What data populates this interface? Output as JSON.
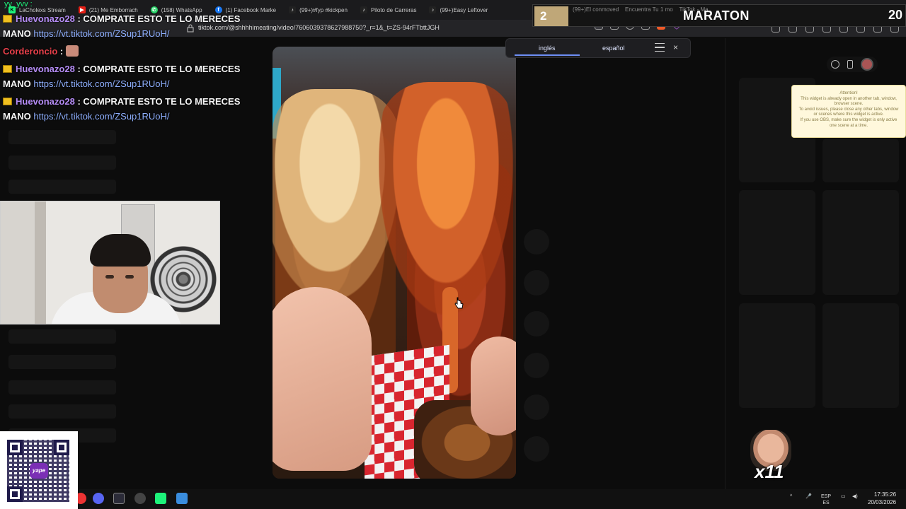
{
  "browser": {
    "tabs": [
      {
        "label": "LaCholexs Stream",
        "fav_color": "#1df27a"
      },
      {
        "label": "(21) Me Emborrach",
        "fav_color": "#e62117"
      },
      {
        "label": "(158) WhatsApp",
        "fav_color": "#25d366"
      },
      {
        "label": "(1) Facebook Marke",
        "fav_color": "#1877f2"
      },
      {
        "label": "(99+)#fyp #kickpen",
        "fav_color": "#222"
      },
      {
        "label": "Piloto de Carreras",
        "fav_color": "#222"
      },
      {
        "label": "(99+)Easy Leftover",
        "fav_color": "#222"
      },
      {
        "label": "(99+)El conmoved",
        "fav_color": "#222"
      },
      {
        "label": "Encuentra Tu 1 mo",
        "fav_color": "#222"
      },
      {
        "label": "TikTok - Ma",
        "fav_color": "#222"
      }
    ],
    "url": "tiktok.com/@shhhhimeating/video/7606039378627988750?_r=1&_t=ZS-94rFTbttJGH"
  },
  "stream": {
    "title": "yy_yvv : ",
    "tab_label": "LaCholexs Stream"
  },
  "chat": [
    {
      "user": "Huevonazo28",
      "message": ": COMPRATE ESTO TE LO MERECES",
      "cont": "MANO",
      "link": "https://vt.tiktok.com/ZSup1RUoH/"
    },
    {
      "user": "Corderoncio",
      "message": ":"
    },
    {
      "user": "Huevonazo28",
      "message": ": COMPRATE ESTO TE LO MERECES",
      "cont": "MANO",
      "link": "https://vt.tiktok.com/ZSup1RUoH/"
    },
    {
      "user": "Huevonazo28",
      "message": ": COMPRATE ESTO TE LO MERECES",
      "cont": "MANO",
      "link": "https://vt.tiktok.com/ZSup1RUoH/"
    }
  ],
  "translate": {
    "lang_from": "inglés",
    "lang_to": "español",
    "close": "×"
  },
  "maraton": {
    "left_number": "2",
    "title": "MARATON",
    "right_number": "20"
  },
  "attention": {
    "lines": [
      "Attention!",
      "This widget is already open in another tab, window,",
      "browser scene.",
      "To avoid issues, please close any other tabs, window",
      "or scenes where this widget is active.",
      "If you use OBS, make sure the widget is only active",
      "one scene at a time."
    ]
  },
  "qr": {
    "center_label": "yape"
  },
  "emote": {
    "text": "x11"
  },
  "taskbar": {
    "lang_top": "ESP",
    "lang_bottom": "ES",
    "time": "17:35:26",
    "date": "20/03/2026"
  },
  "colors": {
    "username_purple": "#b58cf5",
    "username_red": "#e8404a",
    "link_blue": "#8fb0ff",
    "badge_gold": "#f0c020",
    "maraton_gold": "#bfa778"
  }
}
